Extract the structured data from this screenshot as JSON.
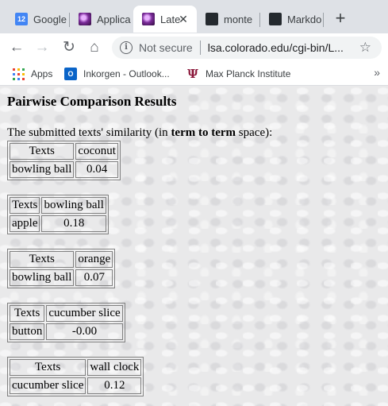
{
  "browser": {
    "tabs": [
      {
        "icon": "calendar-icon",
        "icon_text": "12",
        "label": "Google",
        "active": false
      },
      {
        "icon": "purple-orb-icon",
        "label": "Applica",
        "active": false
      },
      {
        "icon": "purple-orb-icon",
        "label": "Late",
        "active": true
      },
      {
        "icon": "github-icon",
        "label": "monte",
        "active": false
      },
      {
        "icon": "github-icon",
        "label": "Markdo",
        "active": false
      }
    ],
    "close_glyph": "✕",
    "new_tab_glyph": "+",
    "toolbar": {
      "back_glyph": "←",
      "forward_glyph": "→",
      "reload_glyph": "↻",
      "home_glyph": "⌂",
      "security_label": "Not secure",
      "url": "lsa.colorado.edu/cgi-bin/L...",
      "star_glyph": "☆"
    },
    "bookmarks": [
      {
        "icon": "apps-grid-icon",
        "label": "Apps"
      },
      {
        "icon": "outlook-icon",
        "icon_text": "O",
        "label": "Inkorgen - Outlook..."
      },
      {
        "icon": "max-planck-icon",
        "icon_text": "Ψ",
        "label": "Max Planck Institute"
      }
    ],
    "more_glyph": "»"
  },
  "page": {
    "title": "Pairwise Comparison Results",
    "intro_before": "The submitted texts' similarity (in ",
    "intro_bold": "term to term",
    "intro_after": " space):",
    "comparisons": [
      {
        "header_left": "Texts",
        "header_right": "coconut",
        "term": "bowling ball",
        "value": "0.04"
      },
      {
        "header_left": "Texts",
        "header_right": "bowling ball",
        "term": "apple",
        "value": "0.18"
      },
      {
        "header_left": "Texts",
        "header_right": "orange",
        "term": "bowling ball",
        "value": "0.07"
      },
      {
        "header_left": "Texts",
        "header_right": "cucumber slice",
        "term": "button",
        "value": "-0.00"
      },
      {
        "header_left": "Texts",
        "header_right": "wall clock",
        "term": "cucumber slice",
        "value": "0.12"
      }
    ]
  }
}
